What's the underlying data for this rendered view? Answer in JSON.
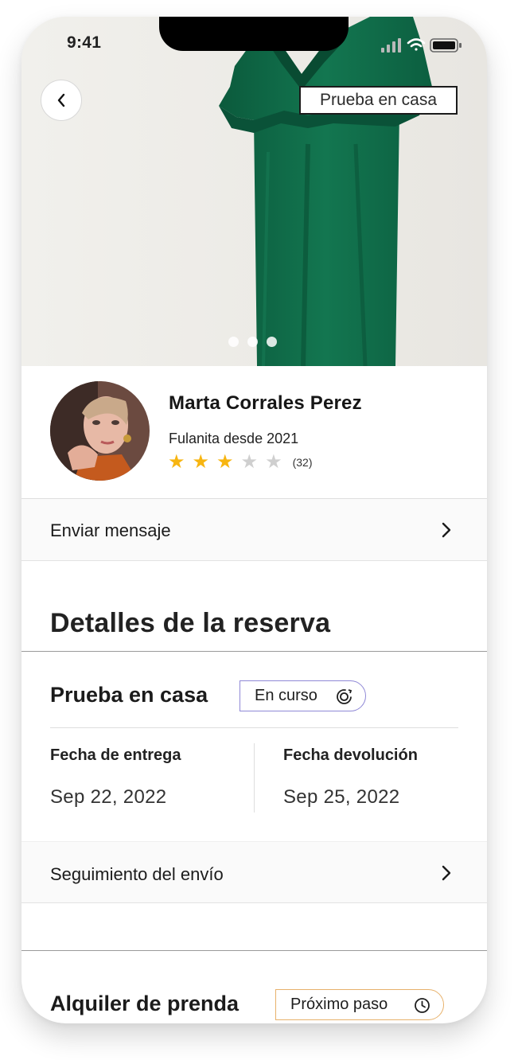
{
  "status_bar": {
    "time": "9:41"
  },
  "hero": {
    "tag": "Prueba en casa",
    "dots": 3
  },
  "profile": {
    "name": "Marta Corrales Perez",
    "since": "Fulanita desde 2021",
    "rating": 3,
    "rating_max": 5,
    "reviews": "(32)"
  },
  "message_row": {
    "label": "Enviar mensaje"
  },
  "booking": {
    "title": "Detalles de la reserva",
    "home_trial": {
      "title": "Prueba en casa",
      "status": "En curso",
      "delivery_label": "Fecha de entrega",
      "delivery_date": "Sep 22, 2022",
      "return_label": "Fecha devolución",
      "return_date": "Sep 25, 2022"
    },
    "tracking": {
      "label": "Seguimiento del envío"
    },
    "rental": {
      "title": "Alquiler de prenda",
      "status": "Próximo paso"
    }
  },
  "colors": {
    "dress": "#0f6a48",
    "star_on": "#f7b511",
    "star_off": "#cfcfcf",
    "pill_curso_border": "#8f88d6",
    "pill_proximo_border": "#e7b16b"
  }
}
